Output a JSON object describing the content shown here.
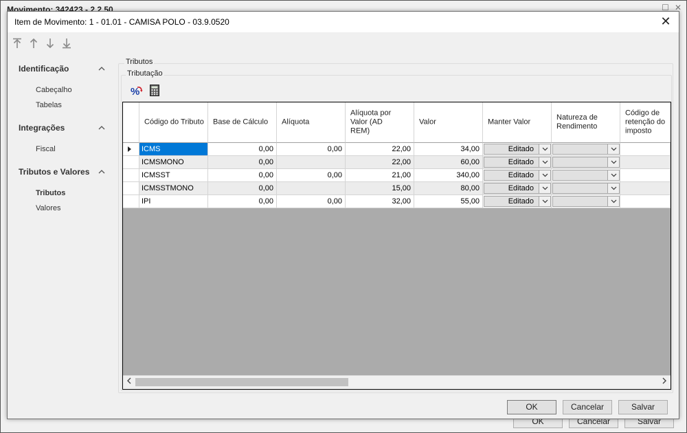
{
  "background_window": {
    "title": "Movimento: 342423 - 2.2.50",
    "buttons": {
      "ok": "OK",
      "cancel": "Cancelar",
      "save": "Salvar"
    }
  },
  "dialog": {
    "title": "Item de Movimento: 1 - 01.01 - CAMISA POLO - 03.9.0520",
    "close_icon": "close-icon",
    "toolbar": [
      "first-record-icon",
      "previous-record-icon",
      "next-record-icon",
      "last-record-icon"
    ],
    "nav": {
      "groups": [
        {
          "label": "Identificação",
          "items": [
            "Cabeçalho",
            "Tabelas"
          ]
        },
        {
          "label": "Integrações",
          "items": [
            "Fiscal"
          ]
        },
        {
          "label": "Tributos e Valores",
          "items": [
            "Tributos",
            "Valores"
          ],
          "active_item": "Tributos"
        }
      ]
    },
    "panel": {
      "group_label": "Tributos",
      "subgroup_label": "Tributação",
      "tool_icons": [
        "percent-recalc-icon",
        "calculator-icon"
      ]
    },
    "grid": {
      "columns": [
        "Código do Tributo",
        "Base de Cálculo",
        "Alíquota",
        "Alíquota por Valor (AD REM)",
        "Valor",
        "Manter Valor",
        "Natureza de Rendimento",
        "Código de retenção do imposto"
      ],
      "rows": [
        {
          "codigo": "ICMS",
          "base": "0,00",
          "aliquota": "0,00",
          "ad_rem": "22,00",
          "valor": "34,00",
          "manter": "Editado",
          "natureza": "",
          "retencao": ""
        },
        {
          "codigo": "ICMSMONO",
          "base": "0,00",
          "aliquota": "",
          "ad_rem": "22,00",
          "valor": "60,00",
          "manter": "Editado",
          "natureza": "",
          "retencao": ""
        },
        {
          "codigo": "ICMSST",
          "base": "0,00",
          "aliquota": "0,00",
          "ad_rem": "21,00",
          "valor": "340,00",
          "manter": "Editado",
          "natureza": "",
          "retencao": ""
        },
        {
          "codigo": "ICMSSTMONO",
          "base": "0,00",
          "aliquota": "",
          "ad_rem": "15,00",
          "valor": "80,00",
          "manter": "Editado",
          "natureza": "",
          "retencao": ""
        },
        {
          "codigo": "IPI",
          "base": "0,00",
          "aliquota": "0,00",
          "ad_rem": "32,00",
          "valor": "55,00",
          "manter": "Editado",
          "natureza": "",
          "retencao": ""
        }
      ],
      "selected_row": 0
    },
    "buttons": {
      "ok": "OK",
      "cancel": "Cancelar",
      "save": "Salvar"
    }
  }
}
